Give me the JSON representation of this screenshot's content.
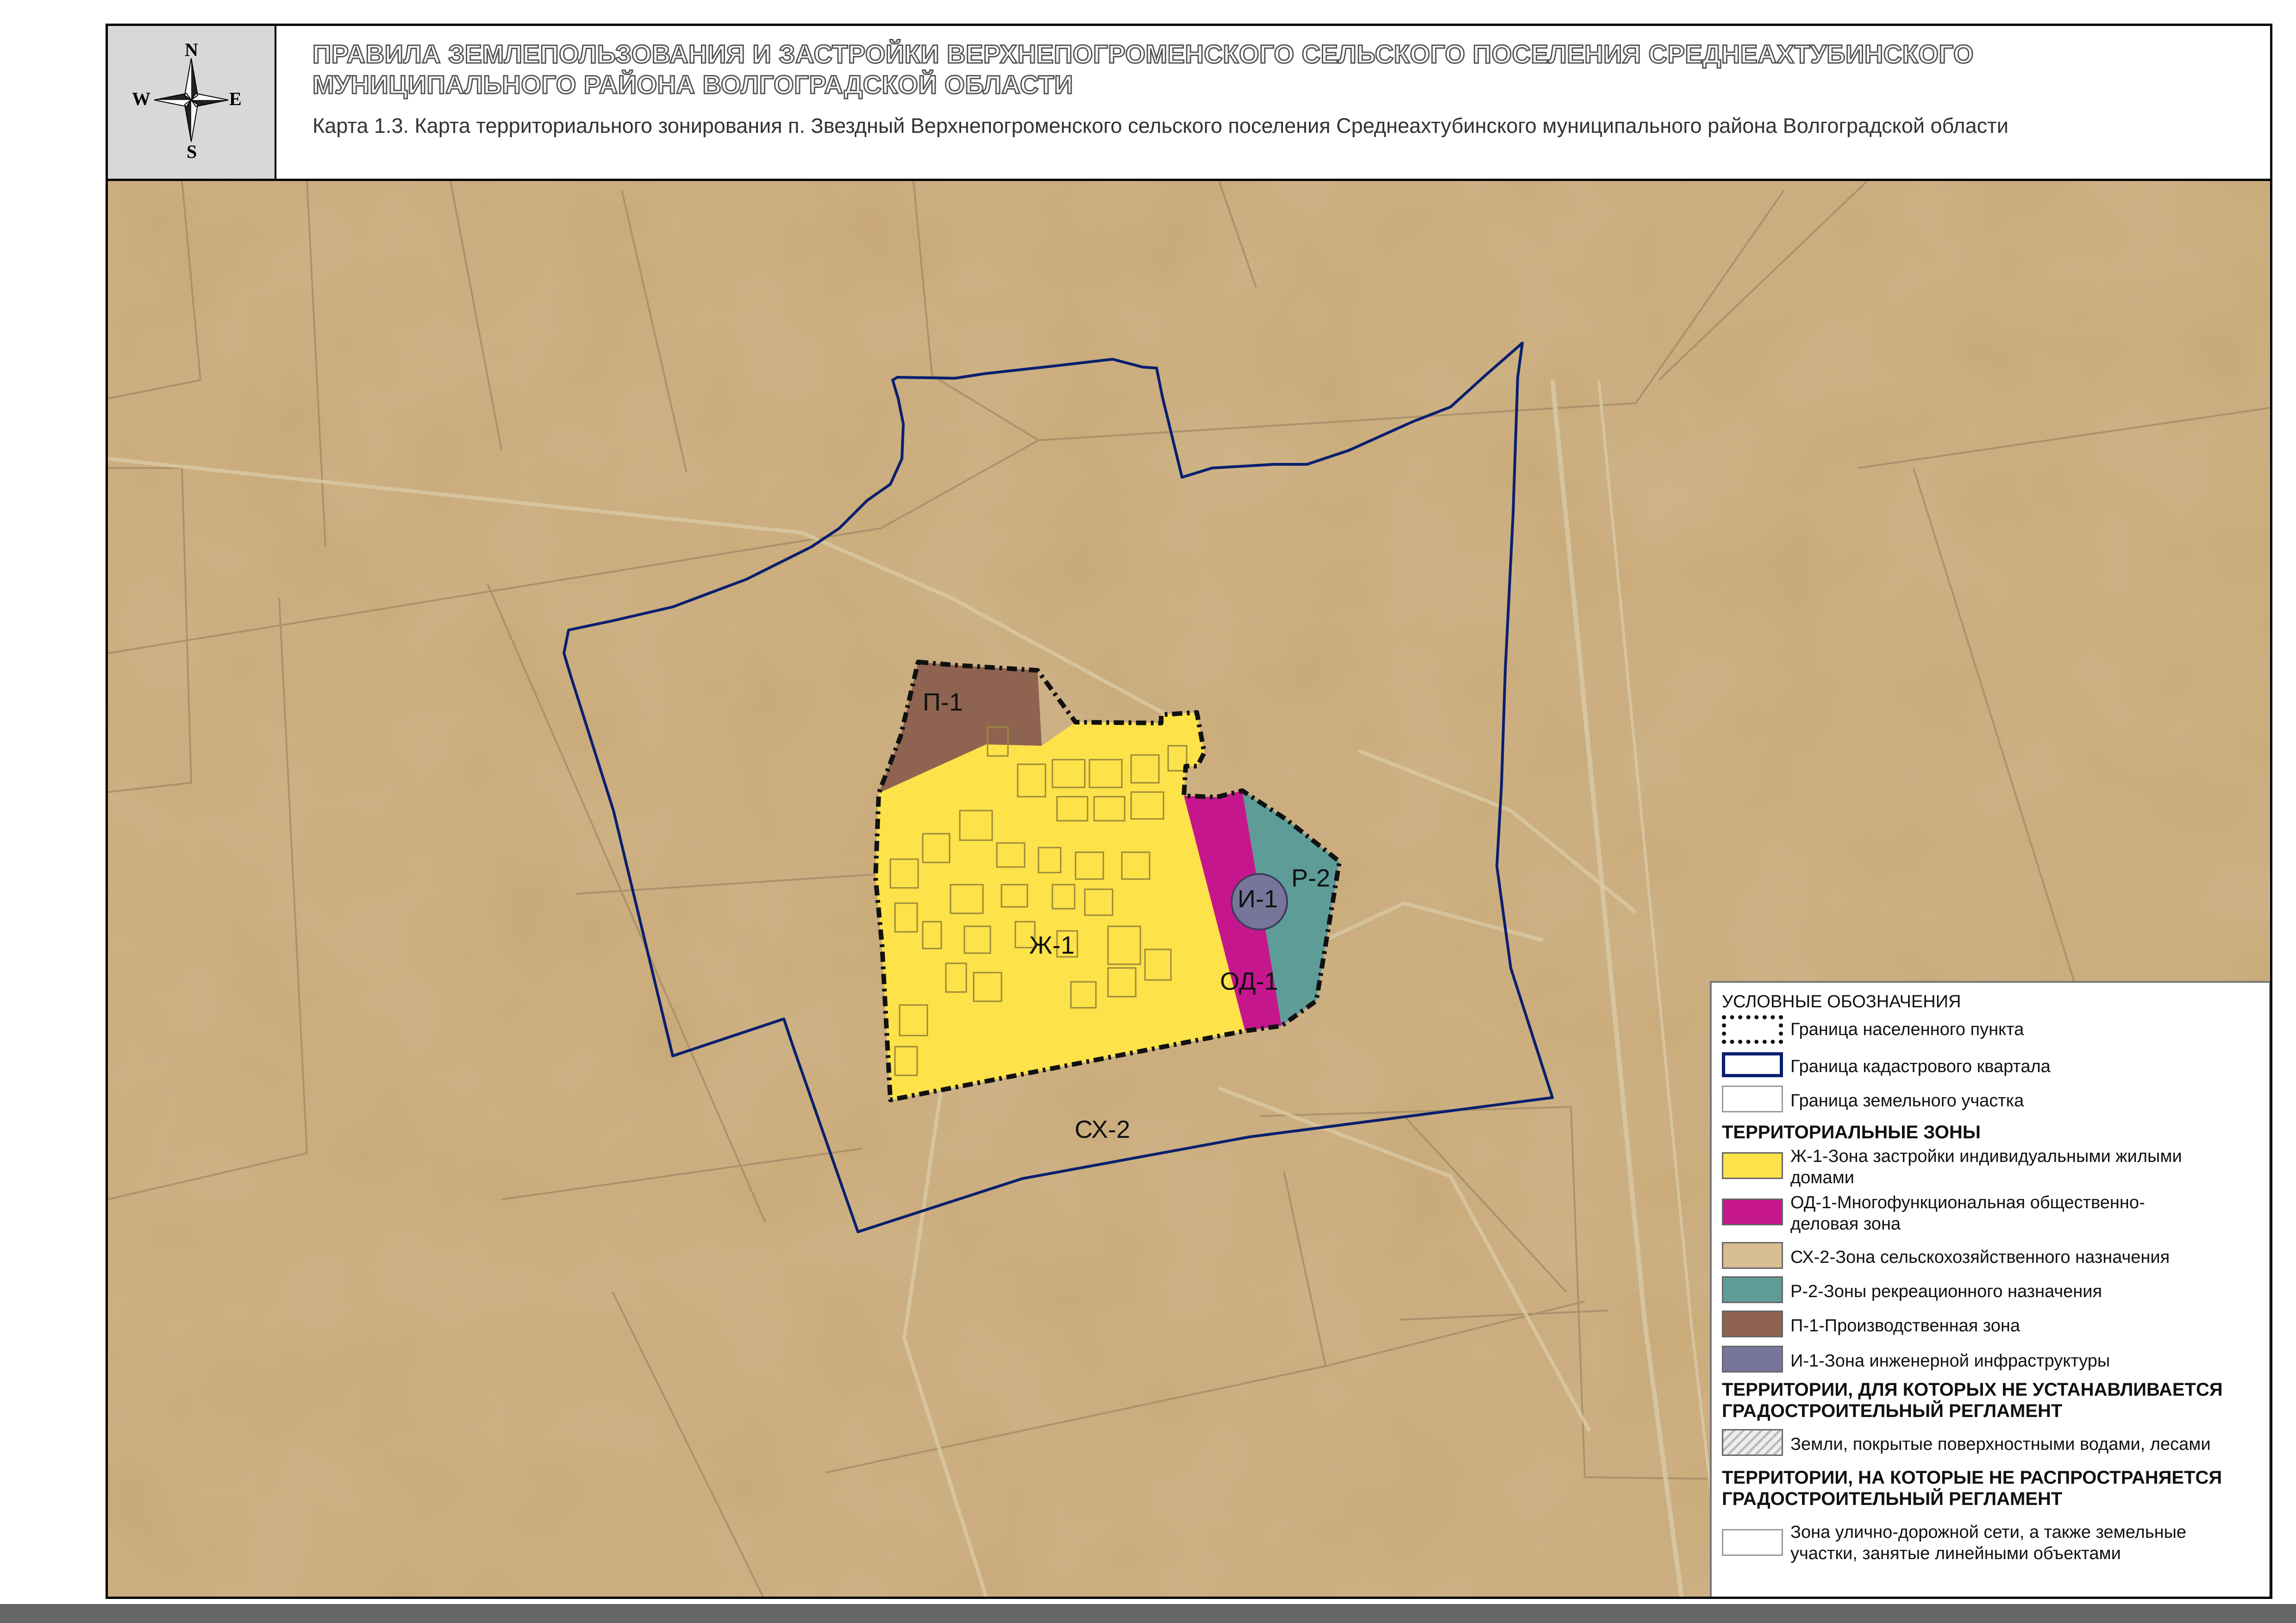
{
  "header": {
    "compass": {
      "n": "N",
      "s": "S",
      "w": "W",
      "e": "E",
      "icon": "compass-rose-icon"
    },
    "title": "ПРАВИЛА ЗЕМЛЕПОЛЬЗОВАНИЯ И ЗАСТРОЙКИ ВЕРХНЕПОГРОМЕНСКОГО СЕЛЬСКОГО ПОСЕЛЕНИЯ СРЕДНЕАХТУБИНСКОГО МУНИЦИПАЛЬНОГО РАЙОНА ВОЛГОГРАДСКОЙ ОБЛАСТИ",
    "subtitle": "Карта 1.3. Карта территориального зонирования п. Звездный Верхнепогроменского сельского поселения Среднеахтубинского муниципального района Волгоградской области"
  },
  "map": {
    "zones": {
      "p1": "П-1",
      "zh1": "Ж-1",
      "od1": "ОД-1",
      "i1": "И-1",
      "r2": "Р-2",
      "sx2": "СХ-2"
    },
    "colors": {
      "background": "#c8a877",
      "zh1": "#fde24a",
      "od1": "#c6168d",
      "r2": "#5e9c98",
      "p1": "#8e6450",
      "i1": "#77769a",
      "quarter_border": "#0a1f6e"
    }
  },
  "legend": {
    "title": "УСЛОВНЫЕ ОБОЗНАЧЕНИЯ",
    "boundaries": [
      {
        "label": "Граница населенного пункта"
      },
      {
        "label": "Граница кадастрового квартала"
      },
      {
        "label": "Граница земельного участка"
      }
    ],
    "zones_title": "ТЕРРИТОРИАЛЬНЫЕ ЗОНЫ",
    "zones": [
      {
        "label": "Ж-1-Зона застройки индивидуальными жилыми домами",
        "color": "#fde24a"
      },
      {
        "label": "ОД-1-Многофункциональная общественно-деловая зона",
        "color": "#c6168d"
      },
      {
        "label": "СХ-2-Зона сельскохозяйственного назначения",
        "color": "#d8bd90"
      },
      {
        "label": "Р-2-Зоны рекреационного назначения",
        "color": "#5e9c98"
      },
      {
        "label": "П-1-Производственная зона",
        "color": "#8e6450"
      },
      {
        "label": "И-1-Зона инженерной инфраструктуры",
        "color": "#77769a"
      }
    ],
    "section2_title": "ТЕРРИТОРИИ, ДЛЯ КОТОРЫХ НЕ УСТАНАВЛИВАЕТСЯ ГРАДОСТРОИТЕЛЬНЫЙ РЕГЛАМЕНТ",
    "section2_item": "Земли, покрытые поверхностными водами, лесами",
    "section3_title": "ТЕРРИТОРИИ, НА КОТОРЫЕ НЕ РАСПРОСТРАНЯЕТСЯ ГРАДОСТРОИТЕЛЬНЫЙ РЕГЛАМЕНТ",
    "section3_item": "Зона улично-дорожной сети, а также земельные участки, занятые линейными объектами"
  }
}
